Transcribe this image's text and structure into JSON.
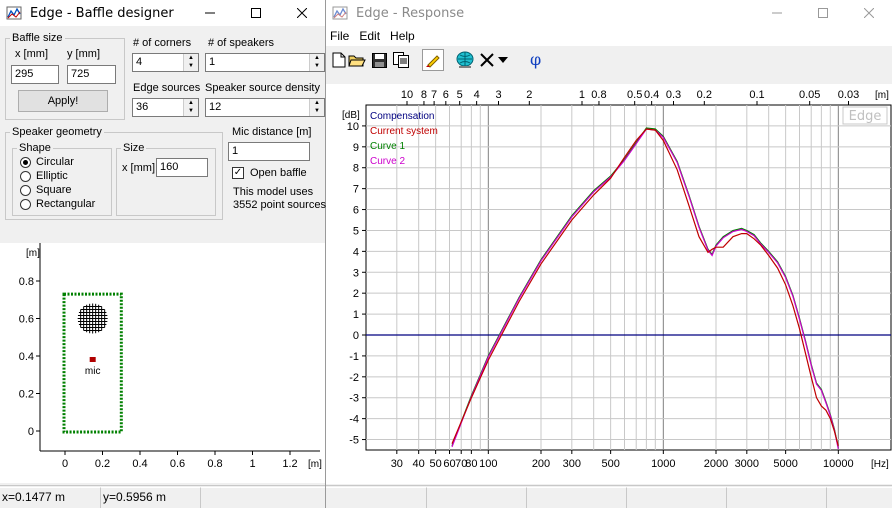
{
  "baffle_window": {
    "title": "Edge - Baffle designer",
    "baffle_size": {
      "group_label": "Baffle size",
      "x_label": "x [mm]",
      "y_label": "y [mm]",
      "x_value": "295",
      "y_value": "725",
      "apply_label": "Apply!"
    },
    "corners": {
      "label": "# of corners",
      "value": "4"
    },
    "speakers": {
      "label": "# of speakers",
      "value": "1"
    },
    "edge_sources": {
      "label": "Edge sources",
      "value": "36"
    },
    "source_density": {
      "label": "Speaker source density",
      "value": "12"
    },
    "speaker_geometry": {
      "group_label": "Speaker geometry",
      "shape_label": "Shape",
      "shapes": [
        "Circular",
        "Elliptic",
        "Square",
        "Rectangular"
      ],
      "selected_shape": "Circular",
      "size_label": "Size",
      "size_x_label": "x [mm]",
      "size_value": "160"
    },
    "mic_distance": {
      "label": "Mic distance [m]",
      "value": "1"
    },
    "open_baffle": {
      "label": "Open baffle",
      "checked": true
    },
    "model_info_line1": "This model uses",
    "model_info_line2": "3552 point sources",
    "geometry_plot": {
      "y_unit": "[m]",
      "x_unit": "[m]",
      "y_ticks": [
        "0.8",
        "0.6",
        "0.4",
        "0.2",
        "0"
      ],
      "x_ticks": [
        "0",
        "0.2",
        "0.4",
        "0.6",
        "0.8",
        "1",
        "1.2"
      ],
      "mic_label": "mic",
      "baffle_width_m": 0.295,
      "baffle_height_m": 0.725,
      "speaker_center_m": [
        0.1475,
        0.6
      ],
      "speaker_diameter_m": 0.16,
      "mic_position_m": [
        0.1477,
        0.3787
      ],
      "frame_color": "#008000",
      "speaker_color": "#000000",
      "mic_color": "#b00000"
    },
    "status": {
      "x": "x=0.1477 m",
      "y": "y=0.5956 m"
    }
  },
  "response_window": {
    "title": "Edge - Response",
    "menu": [
      "File",
      "Edit",
      "Help"
    ],
    "toolbar_icons": [
      "new-document-icon",
      "open-folder-icon",
      "save-icon",
      "copy-icon",
      "pen-icon",
      "globe-icon",
      "close-x-icon",
      "dropdown-arrow-icon",
      "phase-icon"
    ],
    "toolbar_icon_colors": {
      "phase": "#1040c0",
      "globe": "#00b0c0",
      "pen": "#e8c000"
    }
  },
  "chart_data": {
    "type": "line",
    "title": "",
    "watermark": "Edge",
    "ylabel": "[dB]",
    "top_axis_unit": "[m]",
    "xlabel": "[Hz]",
    "x_scale": "log",
    "xlim": [
      20,
      20000
    ],
    "ylim": [
      -5.5,
      11
    ],
    "grid": true,
    "legend_position": "top-left",
    "y_ticks": [
      10,
      9,
      8,
      7,
      6,
      5,
      4,
      3,
      2,
      1,
      0,
      -1,
      -2,
      -3,
      -4,
      -5
    ],
    "x_ticks": [
      30,
      40,
      50,
      60,
      70,
      80,
      100,
      200,
      300,
      500,
      1000,
      2000,
      3000,
      5000,
      10000
    ],
    "top_ticks": [
      "10",
      "8",
      "7",
      "6",
      "5",
      "4",
      "3",
      "2",
      "1",
      "0.8",
      "0.5",
      "0.4",
      "0.3",
      "0.2",
      "0.1",
      "0.05",
      "0.03"
    ],
    "top_tick_values_m": [
      10,
      8,
      7,
      6,
      5,
      4,
      3,
      2,
      1,
      0.8,
      0.5,
      0.4,
      0.3,
      0.2,
      0.1,
      0.05,
      0.03
    ],
    "series": [
      {
        "name": "Compensation",
        "color": "#000080",
        "x": [
          20,
          20000
        ],
        "y": [
          0,
          0
        ]
      },
      {
        "name": "Current system",
        "color": "#c00000",
        "x": [
          62,
          80,
          100,
          150,
          200,
          300,
          400,
          500,
          600,
          700,
          800,
          900,
          1000,
          1200,
          1400,
          1600,
          1800,
          1900,
          2000,
          2200,
          2500,
          2800,
          3000,
          3300,
          3600,
          4000,
          4500,
          5000,
          5500,
          6000,
          6500,
          7000,
          7500,
          8000,
          8500,
          9000,
          9500,
          10000
        ],
        "y": [
          -5.2,
          -3.0,
          -1.2,
          1.6,
          3.4,
          5.5,
          6.7,
          7.5,
          8.5,
          9.3,
          9.85,
          9.8,
          9.3,
          7.9,
          6.2,
          4.7,
          3.95,
          4.1,
          4.2,
          4.2,
          4.7,
          4.85,
          4.85,
          4.6,
          4.3,
          3.8,
          3.2,
          2.4,
          1.4,
          0.3,
          -0.9,
          -2.0,
          -3.0,
          -3.4,
          -3.6,
          -4.0,
          -4.6,
          -5.3
        ]
      },
      {
        "name": "Curve 1",
        "color": "#008000",
        "x": [
          62,
          80,
          100,
          150,
          200,
          300,
          400,
          500,
          600,
          700,
          800,
          900,
          1000,
          1200,
          1400,
          1600,
          1800,
          1900,
          2000,
          2200,
          2500,
          2800,
          3000,
          3300,
          3600,
          4000,
          4500,
          5000,
          5500,
          6000,
          6500,
          7000,
          7500,
          8000,
          8500,
          9000,
          9500,
          10000
        ],
        "y": [
          -5.3,
          -2.9,
          -1.0,
          1.8,
          3.6,
          5.7,
          6.9,
          7.6,
          8.4,
          9.2,
          9.9,
          9.85,
          9.5,
          8.3,
          6.7,
          5.2,
          4.1,
          3.85,
          4.3,
          4.7,
          5.0,
          5.1,
          5.0,
          4.8,
          4.4,
          4.0,
          3.5,
          2.8,
          1.9,
          0.8,
          -0.3,
          -1.4,
          -2.3,
          -2.6,
          -3.2,
          -3.8,
          -4.5,
          -5.4
        ]
      },
      {
        "name": "Curve 2",
        "color": "#cc00cc",
        "x": [
          62,
          80,
          100,
          150,
          200,
          300,
          400,
          500,
          600,
          700,
          800,
          900,
          1000,
          1200,
          1400,
          1600,
          1800,
          1900,
          2000,
          2200,
          2500,
          2800,
          3000,
          3300,
          3600,
          4000,
          4500,
          5000,
          5500,
          6000,
          6500,
          7000,
          7500,
          8000,
          8500,
          9000,
          9500,
          10000
        ],
        "y": [
          -5.35,
          -2.95,
          -1.05,
          1.75,
          3.55,
          5.65,
          6.85,
          7.55,
          8.35,
          9.15,
          9.85,
          9.8,
          9.45,
          8.25,
          6.65,
          5.15,
          4.05,
          3.8,
          4.25,
          4.65,
          4.95,
          5.05,
          4.95,
          4.75,
          4.35,
          3.95,
          3.45,
          2.75,
          1.85,
          0.75,
          -0.35,
          -1.45,
          -2.35,
          -2.65,
          -3.25,
          -3.85,
          -4.55,
          -5.45
        ]
      }
    ]
  }
}
